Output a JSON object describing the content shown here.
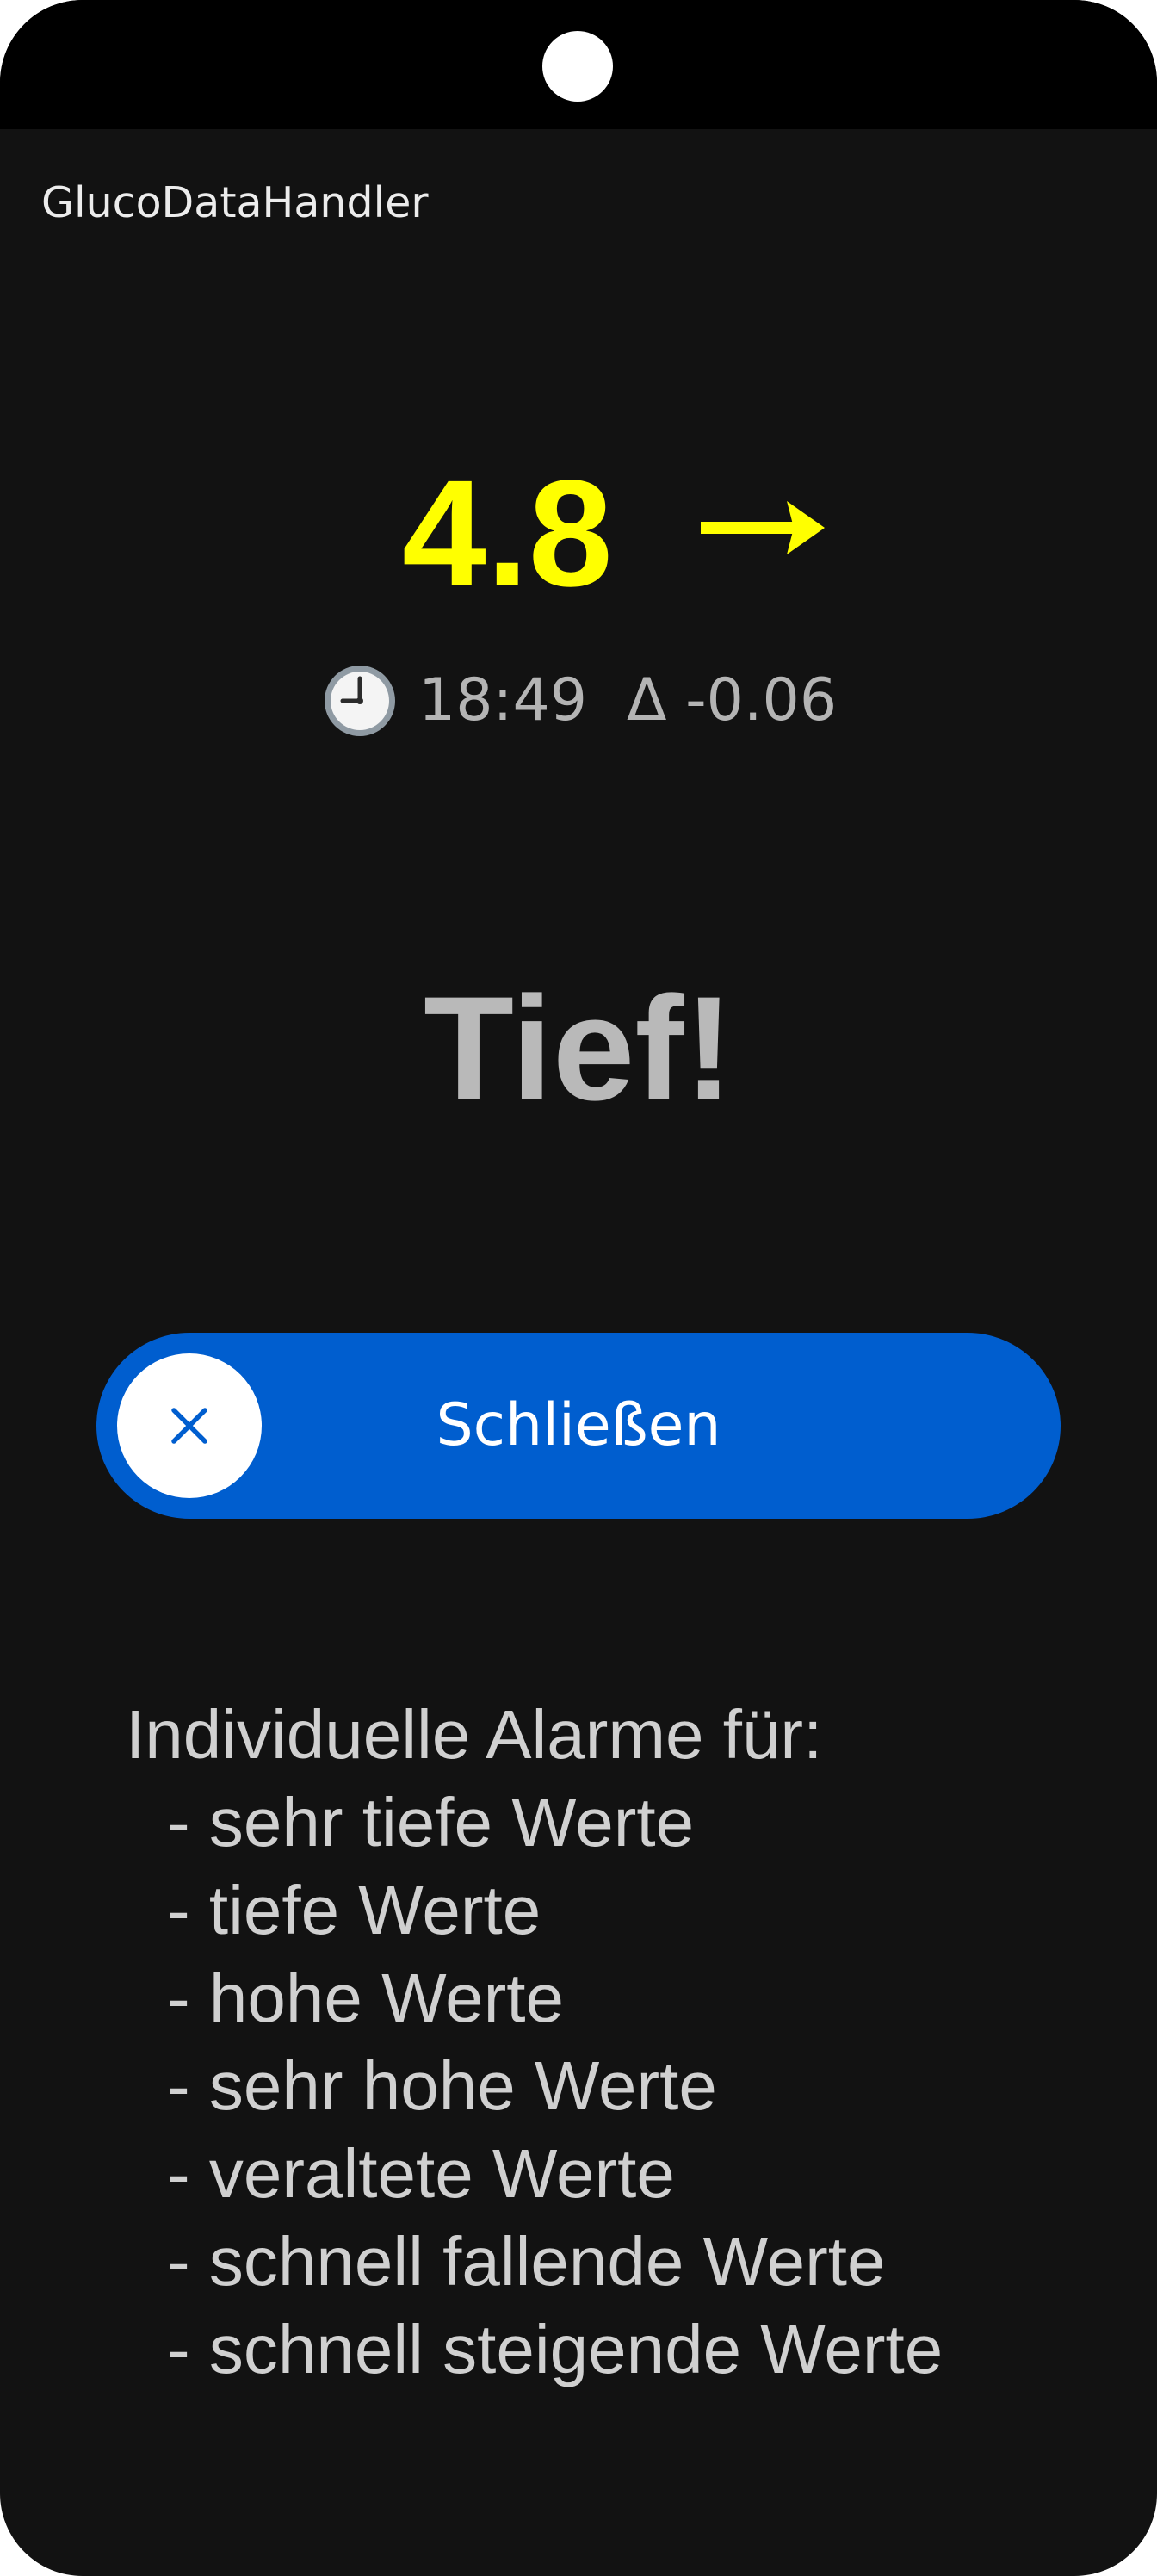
{
  "app": {
    "title": "GlucoDataHandler"
  },
  "glucose": {
    "value": "4.8",
    "trend_icon": "arrow-right-icon",
    "color": "#ffff00",
    "clock_icon": "clock-icon",
    "time": "18:49",
    "delta": "Δ -0.06"
  },
  "alarm": {
    "title": "Tief!"
  },
  "close_slider": {
    "label": "Schließen",
    "icon": "close-icon",
    "color": "#005ecf"
  },
  "description": {
    "heading": "Individuelle Alarme für:",
    "items": [
      "- sehr tiefe Werte",
      "- tiefe Werte",
      "- hohe Werte",
      "- sehr hohe Werte",
      "- veraltete Werte",
      "- schnell fallende Werte",
      "- schnell steigende Werte"
    ]
  }
}
